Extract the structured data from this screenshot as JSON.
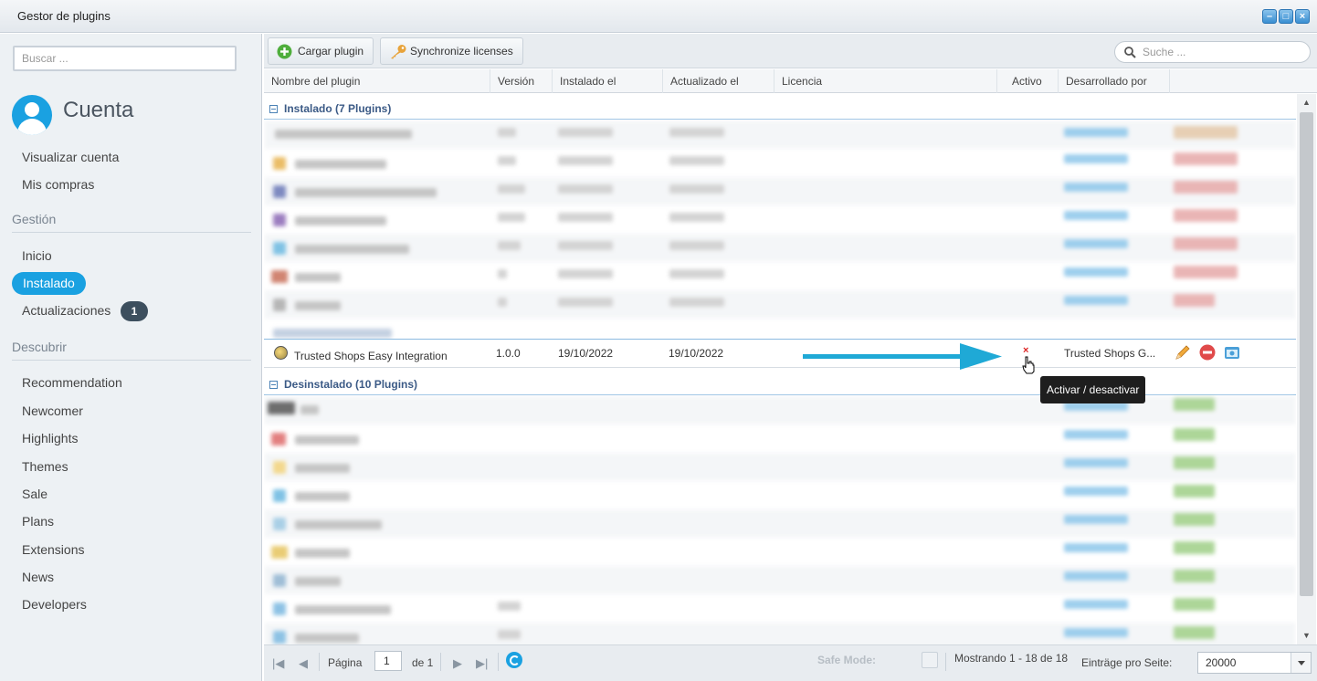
{
  "window": {
    "title": "Gestor de plugins"
  },
  "sidebar": {
    "search_placeholder": "Buscar ...",
    "account_title": "Cuenta",
    "account_items": [
      "Visualizar cuenta",
      "Mis compras"
    ],
    "management_heading": "Gestión",
    "management_items": [
      "Inicio",
      "Instalado",
      "Actualizaciones"
    ],
    "updates_badge": "1",
    "discover_heading": "Descubrir",
    "discover_items": [
      "Recommendation",
      "Newcomer",
      "Highlights",
      "Themes",
      "Sale",
      "Plans",
      "Extensions",
      "News",
      "Developers"
    ]
  },
  "toolbar": {
    "upload_label": "Cargar plugin",
    "sync_label": "Synchronize licenses",
    "search_placeholder": "Suche ..."
  },
  "columns": [
    "Nombre del plugin",
    "Versión",
    "Instalado el",
    "Actualizado el",
    "Licencia",
    "Activo",
    "Desarrollado por"
  ],
  "groups": {
    "installed": "Instalado (7 Plugins)",
    "uninstalled": "Desinstalado (10 Plugins)"
  },
  "highlighted_plugin": {
    "name": "Trusted Shops Easy Integration",
    "version": "1.0.0",
    "installed_on": "19/10/2022",
    "updated_on": "19/10/2022",
    "active_state": "×",
    "developer": "Trusted Shops G..."
  },
  "tooltip": "Activar / desactivar",
  "pager": {
    "page_label": "Página",
    "page_value": "1",
    "of_label": "de 1",
    "safe_mode_label": "Safe Mode:",
    "showing": "Mostrando 1 - 18 de 18",
    "per_page_label": "Einträge pro Seite:",
    "per_page_value": "20000"
  },
  "colors": {
    "accent": "#1aa1e1",
    "group_text": "#3b5a86",
    "link": "#1a8fd5",
    "arrow": "#1fa9d6"
  }
}
